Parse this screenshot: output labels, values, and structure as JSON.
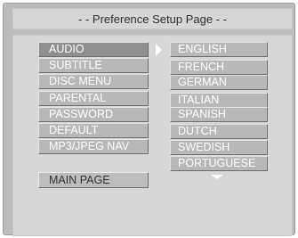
{
  "title": "- - Preference Setup Page - -",
  "menu": {
    "items": [
      "AUDIO",
      "SUBTITLE",
      "DISC MENU",
      "PARENTAL",
      "PASSWORD",
      "DEFAULT",
      "MP3/JPEG NAV"
    ],
    "selected": "AUDIO",
    "main_page": "MAIN PAGE"
  },
  "options": {
    "items": [
      "ENGLISH",
      "FRENCH",
      "GERMAN",
      "ITALIAN",
      "SPANISH",
      "DUTCH",
      "SWEDISH",
      "PORTUGUESE"
    ]
  },
  "icons": {
    "selection": "arrow-right-icon",
    "more": "arrow-down-icon"
  },
  "colors": {
    "screen_bg": "#bcbcbc",
    "panel_bg": "#d7d7d7",
    "button_bg": "#b8b8b8",
    "selected_bg": "#8f8f8f",
    "text_light": "#ffffff",
    "text_dark": "#2e2e2e"
  }
}
